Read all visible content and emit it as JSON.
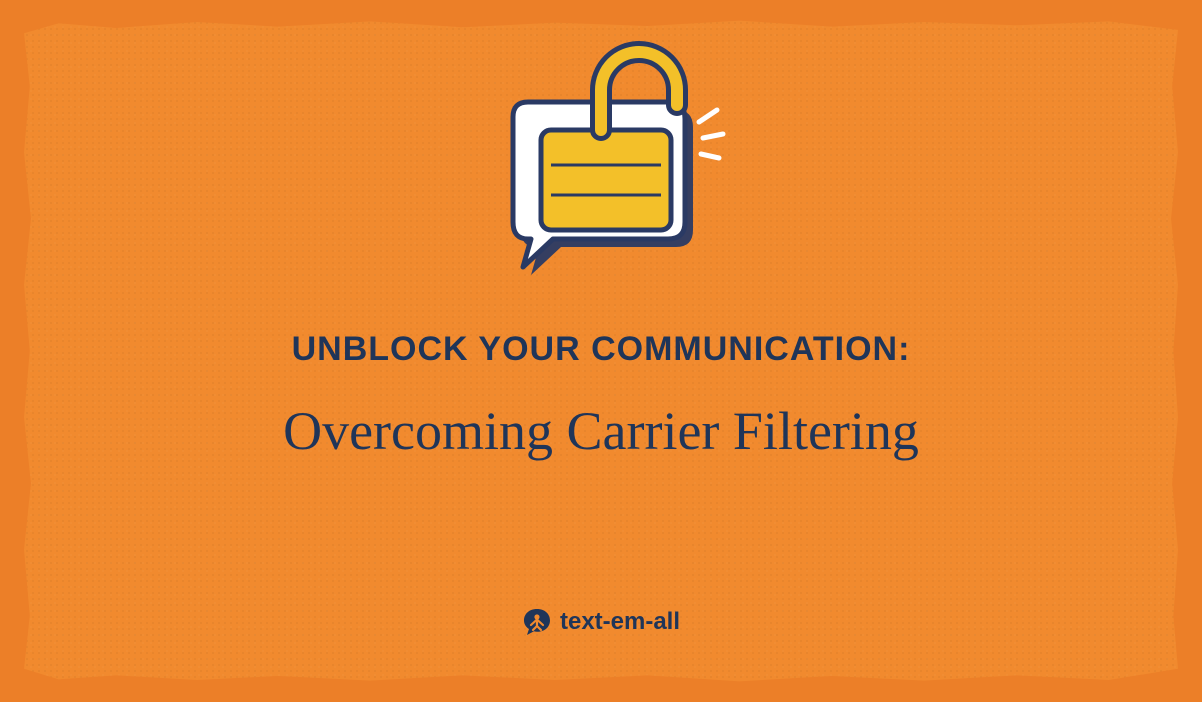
{
  "heading": "UNBLOCK YOUR COMMUNICATION:",
  "subheading": "Overcoming Carrier Filtering",
  "brand": "text-em-all",
  "colors": {
    "bg_outer": "#ec7f28",
    "bg_inner": "#f18a2e",
    "text": "#1f3559",
    "lock_body": "#f3c029",
    "lock_outline": "#2a3a64",
    "bubble_fill": "#ffffff"
  },
  "icons": {
    "illustration": "speech-bubble-with-open-padlock",
    "logo": "speech-bubble-person"
  }
}
